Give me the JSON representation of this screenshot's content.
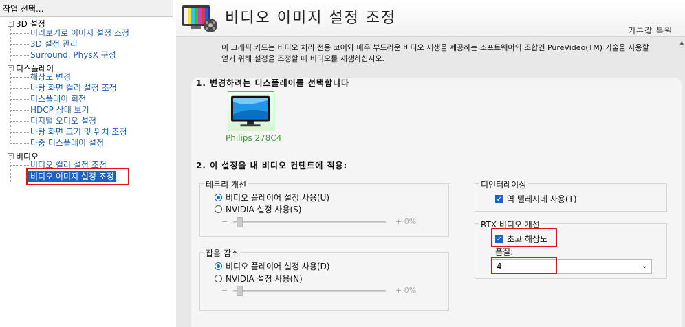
{
  "left_pane": {
    "header": "작업 선택...",
    "categories": [
      {
        "label": "3D 설정",
        "items": [
          "미리보기로 이미지 설정 조정",
          "3D 설정 관리",
          "Surround, PhysX 구성"
        ]
      },
      {
        "label": "디스플레이",
        "items": [
          "해상도 변경",
          "바탕 화면 컬러 설정 조정",
          "디스플레이 회전",
          "HDCP 상태 보기",
          "디지털 오디오 설정",
          "바탕 화면 크기 및 위치 조정",
          "다중 디스플레이 설정"
        ]
      },
      {
        "label": "비디오",
        "items": [
          "비디오 컬러 설정 조정",
          "비디오 이미지 설정 조정"
        ]
      }
    ],
    "expander_symbol": "−"
  },
  "header": {
    "title": "비디오 이미지 설정 조정",
    "restore": "기본값 복원"
  },
  "description": {
    "line1": "이 그래픽 카드는 비디오 처리 전용 코어와 매우 부드러운 비디오 재생을 제공하는 소프트웨어의 조합인 PureVideo(TM) 기술을 사용할",
    "line2": "얻기 위해 설정을 조정할 때 비디오를 재생하십시오."
  },
  "section1": {
    "title": "1. 변경하려는 디스플레이를 선택합니다",
    "display_name": "Philips 278C4"
  },
  "section2": {
    "title": "2. 이 설정을 내 비디오 컨텐트에 적용:",
    "edge": {
      "label": "테두리 개선",
      "option1": "비디오 플레이어 설정 사용(U)",
      "option2": "NVIDIA 설정 사용(S)",
      "minus": "−",
      "plus_value": "+ 0%"
    },
    "noise": {
      "label": "잡음 감소",
      "option1": "비디오 플레이어 설정 사용(D)",
      "option2": "NVIDIA 설정 사용(N)",
      "minus": "−",
      "plus_value": "+ 0%"
    },
    "deinterlace": {
      "label": "디인터레이싱",
      "checkbox": "역 텔레시네 사용(T)"
    },
    "rtx": {
      "label": "RTX 비디오 개선",
      "checkbox": "초고 해상도",
      "quality_label": "품질:",
      "quality_value": "4"
    }
  },
  "colors": {
    "accent": "#1a64c8",
    "highlight_border": "#e0121b",
    "link": "#1f5fb3",
    "display_caption": "#37a32f"
  },
  "icons": {
    "check": "✓",
    "chevron": "⌄"
  }
}
